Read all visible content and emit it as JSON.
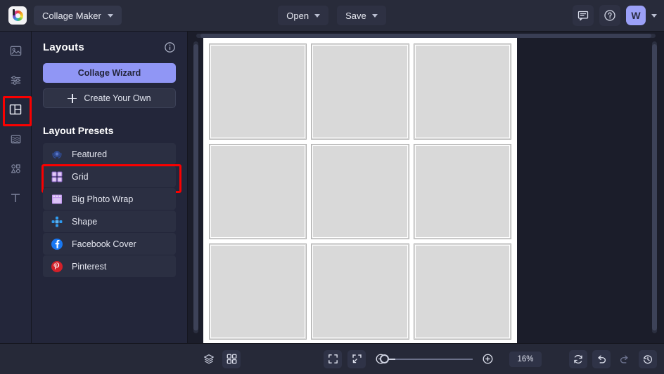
{
  "app": {
    "background_color": "#1f212e",
    "accent_color": "#9096f5",
    "highlight_color": "#fa0000"
  },
  "topbar": {
    "logo_icon": "befunky-logo-icon",
    "document_menu": {
      "label": "Collage Maker",
      "icon": "chevron-down-icon"
    },
    "open_button": {
      "label": "Open",
      "icon": "chevron-down-icon"
    },
    "save_button": {
      "label": "Save",
      "icon": "chevron-down-icon"
    },
    "feedback_icon": "comment-icon",
    "help_icon": "question-circle-icon",
    "avatar": {
      "initial": "W",
      "color": "#9ba0f7"
    },
    "account_caret_icon": "chevron-down-icon"
  },
  "rail": {
    "items": [
      {
        "name": "image-manager",
        "icon": "image-icon",
        "highlighted": false
      },
      {
        "name": "edit-adjust",
        "icon": "sliders-icon",
        "highlighted": false
      },
      {
        "name": "layouts",
        "icon": "layouts-icon",
        "highlighted": true
      },
      {
        "name": "backgrounds",
        "icon": "texture-layers-icon",
        "highlighted": false
      },
      {
        "name": "graphics",
        "icon": "shapes-icon",
        "highlighted": false
      },
      {
        "name": "text",
        "icon": "text-t-icon",
        "highlighted": false
      }
    ]
  },
  "panel": {
    "title": "Layouts",
    "info_icon": "info-circle-icon",
    "collage_wizard_button": "Collage Wizard",
    "create_your_own_button": "Create Your Own",
    "create_your_own_icon": "plus-icon",
    "presets_title": "Layout Presets",
    "presets": [
      {
        "label": "Featured",
        "icon": "laurel-badge-icon",
        "color": "#2f4a8f",
        "highlighted": false
      },
      {
        "label": "Grid",
        "icon": "grid-2x2-icon",
        "color": "#c5a9f0",
        "highlighted": true
      },
      {
        "label": "Big Photo Wrap",
        "icon": "photo-frame-icon",
        "color": "#c49bf0",
        "highlighted": false
      },
      {
        "label": "Shape",
        "icon": "plus-cluster-icon",
        "color": "#2f9bf0",
        "highlighted": false
      },
      {
        "label": "Facebook Cover",
        "icon": "facebook-icon",
        "color": "#1877f2",
        "highlighted": false
      },
      {
        "label": "Pinterest",
        "icon": "pinterest-icon",
        "color": "#d32029",
        "highlighted": false
      }
    ]
  },
  "canvas": {
    "artboard_background": "#ffffff",
    "cell_color": "#d9d9d9",
    "cell_count": 9,
    "columns": 3,
    "rows": 3,
    "horizontal_scrollbar": "h-scrollbar",
    "left_scrollbar": "v-scrollbar-left",
    "right_scrollbar": "v-scrollbar-right"
  },
  "bottombar": {
    "layers_icon": "layers-icon",
    "grid_view_icon": "grid-apps-icon",
    "fullscreen_icon": "expand-frame-icon",
    "fit_screen_icon": "fit-to-screen-icon",
    "zoom_out_icon": "zoom-out-minus-icon",
    "zoom_in_icon": "zoom-in-plus-icon",
    "zoom_level": "16%",
    "reset_icon": "refresh-reset-icon",
    "undo_icon": "undo-arrow-icon",
    "redo_icon": "redo-arrow-icon",
    "history_icon": "history-clock-icon"
  }
}
